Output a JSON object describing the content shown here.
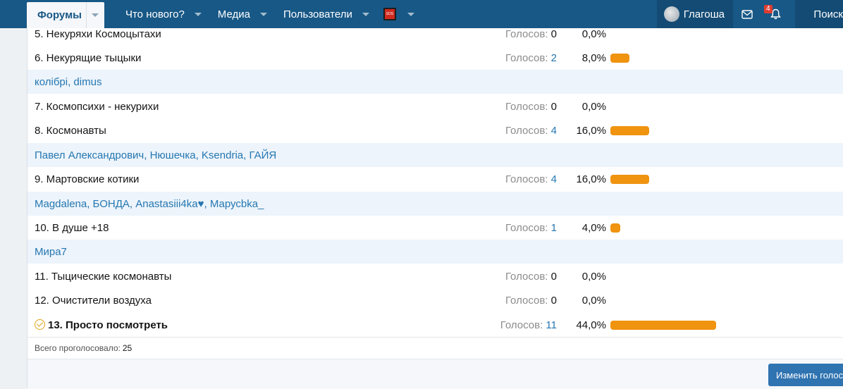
{
  "nav": {
    "forums": "Форумы",
    "whats_new": "Что нового?",
    "media": "Медиа",
    "users": "Пользователи",
    "sos_label": "SOS",
    "username": "Глагоша",
    "notifications_count": "4",
    "search": "Поиск"
  },
  "poll": {
    "votes_label": "Голосов:",
    "responses": [
      {
        "text": "5. Некуряхи Космоцытахи",
        "votes": "0",
        "percent": "0,0%",
        "fraction": 0.0
      },
      {
        "text": "6. Некурящие тыцыки",
        "votes": "2",
        "percent": "8,0%",
        "fraction": 0.08
      },
      {
        "text": "7. Космопсихи - некурихи",
        "votes": "0",
        "percent": "0,0%",
        "fraction": 0.0
      },
      {
        "text": "8. Космонавты",
        "votes": "4",
        "percent": "16,0%",
        "fraction": 0.16
      },
      {
        "text": "9. Мартовские котики",
        "votes": "4",
        "percent": "16,0%",
        "fraction": 0.16
      },
      {
        "text": "10. В душе +18",
        "votes": "1",
        "percent": "4,0%",
        "fraction": 0.04
      },
      {
        "text": "11. Тыцические космонавты",
        "votes": "0",
        "percent": "0,0%",
        "fraction": 0.0
      },
      {
        "text": "12. Очистители воздуха",
        "votes": "0",
        "percent": "0,0%",
        "fraction": 0.0
      },
      {
        "text": "13. Просто посмотреть",
        "votes": "11",
        "percent": "44,0%",
        "fraction": 0.44
      }
    ],
    "voters": [
      "колібрі, dimus",
      "Павел Александрович, Нюшечка, Ksendria, ГАЙЯ",
      "Magdalena, БОНДА, Anastasiii4ka♥, Марусbka_",
      "Мира7"
    ],
    "total_label": "Всего проголосовало:",
    "total": "25",
    "change_button": "Изменить голос"
  },
  "colors": {
    "nav_bg": "#185886",
    "bar": "#f0930f",
    "link": "#2577b1",
    "voters_bg": "#edf4fb"
  }
}
